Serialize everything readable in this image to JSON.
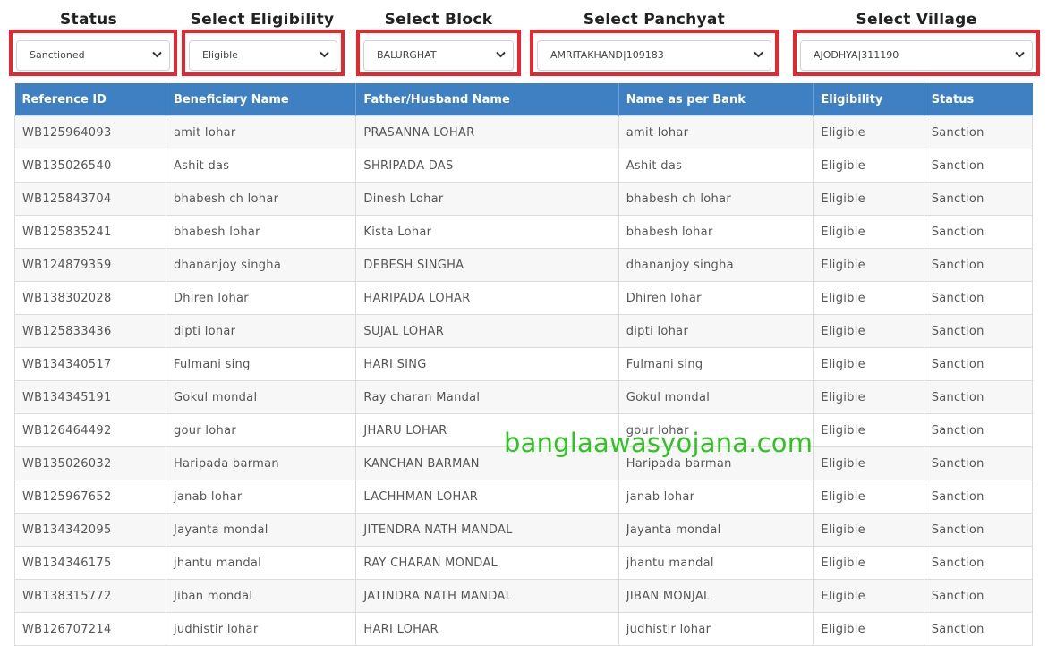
{
  "filters": [
    {
      "label": "Status",
      "value": "Sanctioned"
    },
    {
      "label": "Select Eligibility",
      "value": "Eligible"
    },
    {
      "label": "Select Block",
      "value": "BALURGHAT"
    },
    {
      "label": "Select Panchyat",
      "value": "AMRITAKHAND|109183"
    },
    {
      "label": "Select Village",
      "value": "AJODHYA|311190"
    }
  ],
  "colors": {
    "highlight_border": "#e8262d",
    "header_bg": "#3f80c3",
    "watermark": "#2dc51f"
  },
  "table": {
    "headers": [
      "Reference ID",
      "Beneficiary Name",
      "Father/Husband Name",
      "Name as per Bank",
      "Eligibility",
      "Status"
    ],
    "rows": [
      [
        "WB125964093",
        "amit lohar",
        "PRASANNA LOHAR",
        "amit lohar",
        "Eligible",
        "Sanction"
      ],
      [
        "WB135026540",
        "Ashit das",
        "SHRIPADA DAS",
        "Ashit das",
        "Eligible",
        "Sanction"
      ],
      [
        "WB125843704",
        "bhabesh ch lohar",
        "Dinesh Lohar",
        "bhabesh ch lohar",
        "Eligible",
        "Sanction"
      ],
      [
        "WB125835241",
        "bhabesh lohar",
        "Kista Lohar",
        "bhabesh lohar",
        "Eligible",
        "Sanction"
      ],
      [
        "WB124879359",
        "dhananjoy singha",
        "DEBESH SINGHA",
        "dhananjoy singha",
        "Eligible",
        "Sanction"
      ],
      [
        "WB138302028",
        "Dhiren lohar",
        "HARIPADA LOHAR",
        "Dhiren lohar",
        "Eligible",
        "Sanction"
      ],
      [
        "WB125833436",
        "dipti lohar",
        "SUJAL LOHAR",
        "dipti lohar",
        "Eligible",
        "Sanction"
      ],
      [
        "WB134340517",
        "Fulmani sing",
        "HARI SING",
        "Fulmani sing",
        "Eligible",
        "Sanction"
      ],
      [
        "WB134345191",
        "Gokul mondal",
        "Ray charan Mandal",
        "Gokul mondal",
        "Eligible",
        "Sanction"
      ],
      [
        "WB126464492",
        "gour lohar",
        "JHARU LOHAR",
        "gour lohar",
        "Eligible",
        "Sanction"
      ],
      [
        "WB135026032",
        "Haripada barman",
        "KANCHAN BARMAN",
        "Haripada barman",
        "Eligible",
        "Sanction"
      ],
      [
        "WB125967652",
        "janab lohar",
        "LACHHMAN LOHAR",
        "janab lohar",
        "Eligible",
        "Sanction"
      ],
      [
        "WB134342095",
        "Jayanta mondal",
        "JITENDRA NATH MANDAL",
        "Jayanta mondal",
        "Eligible",
        "Sanction"
      ],
      [
        "WB134346175",
        "jhantu mandal",
        "RAY CHARAN MONDAL",
        "jhantu mandal",
        "Eligible",
        "Sanction"
      ],
      [
        "WB138315772",
        "Jiban mondal",
        "JATINDRA NATH MANDAL",
        "JIBAN MONJAL",
        "Eligible",
        "Sanction"
      ],
      [
        "WB126707214",
        "judhistir lohar",
        "HARI LOHAR",
        "judhistir lohar",
        "Eligible",
        "Sanction"
      ]
    ]
  },
  "watermark": "banglaawasyojana.com"
}
